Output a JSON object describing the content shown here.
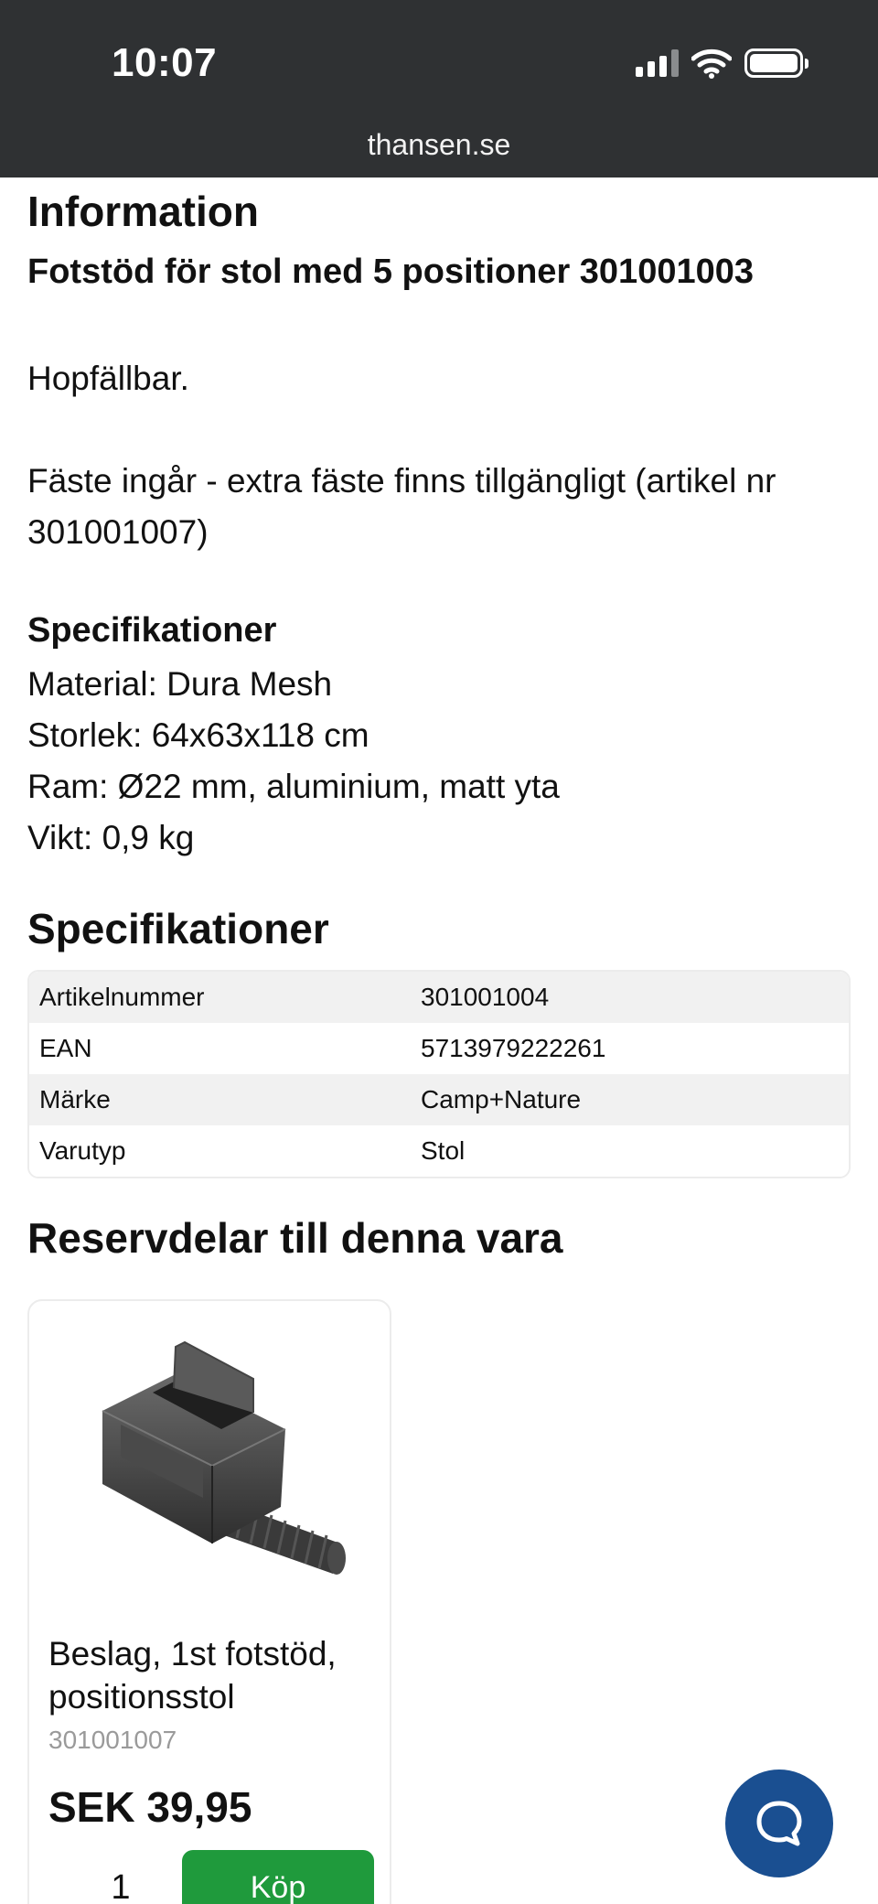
{
  "status_bar": {
    "time": "10:07",
    "url": "thansen.se"
  },
  "info": {
    "heading": "Information",
    "product_title": "Fotstöd för stol med 5 positioner 301001003",
    "para1": "Hopfällbar.",
    "para2": "Fäste ingår - extra fäste finns tillgängligt (artikel nr 301001007)",
    "spec_heading": "Specifikationer",
    "spec_lines": [
      "Material: Dura Mesh",
      "Storlek: 64x63x118 cm",
      "Ram: Ø22 mm, aluminium, matt yta",
      "Vikt: 0,9 kg"
    ]
  },
  "specs": {
    "heading": "Specifikationer",
    "rows": [
      {
        "key": "Artikelnummer",
        "value": "301001004"
      },
      {
        "key": "EAN",
        "value": "5713979222261"
      },
      {
        "key": "Märke",
        "value": "Camp+Nature"
      },
      {
        "key": "Varutyp",
        "value": "Stol"
      }
    ]
  },
  "parts": {
    "heading": "Reservdelar till denna vara",
    "items": [
      {
        "title": "Beslag, 1st fotstöd, positionsstol",
        "sku": "301001007",
        "price": "SEK 39,95",
        "quantity": "1",
        "buy_label": "Köp"
      }
    ]
  },
  "icons": {
    "chat": "chat-bubble-icon",
    "signal": "cellular-signal-icon",
    "wifi": "wifi-icon",
    "battery": "battery-icon"
  },
  "colors": {
    "status_bar": "#2f3133",
    "buy_button": "#1f9a3c",
    "chat_button": "#1a4f91"
  }
}
